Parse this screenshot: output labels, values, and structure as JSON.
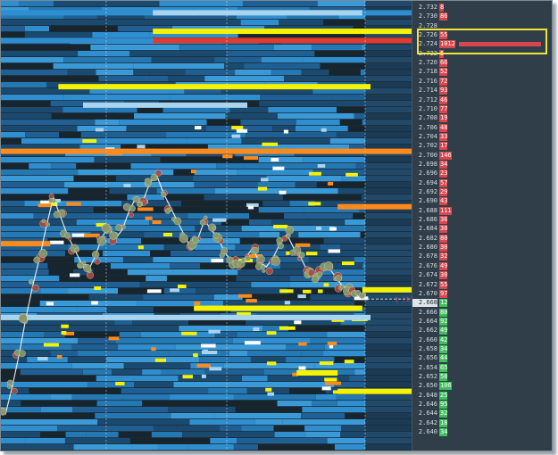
{
  "colors": {
    "background": "#1e2a33",
    "ladder_background": "#2f3e49",
    "ask_volume": "#d9464c",
    "bid_volume": "#3fbf59",
    "liquidity_low": "#1f5f93",
    "liquidity_mid": "#2e8ed0",
    "liquidity_light": "#a9d4ef",
    "liquidity_high": "#f7f200",
    "liquidity_very_high": "#ff8a1c",
    "liquidity_max": "#e43a2c",
    "trade_bubble": "#b04a3c",
    "highlight_box": "#f0e33a",
    "current_price_marker": "#d9464c"
  },
  "current_price_marker": "1 (1)",
  "ladder": {
    "current_price": "2.668",
    "rows": [
      {
        "price": "2.732",
        "volume": "8",
        "side": "ask",
        "bar": 0
      },
      {
        "price": "2.730",
        "volume": "86",
        "side": "ask",
        "bar": 0
      },
      {
        "price": "2.728",
        "volume": "",
        "side": "ask",
        "bar": 0
      },
      {
        "price": "2.726",
        "volume": "55",
        "side": "ask",
        "bar": 0
      },
      {
        "price": "2.724",
        "volume": "1012",
        "side": "ask",
        "bar": 1012
      },
      {
        "price": "2.722",
        "volume": "5",
        "side": "ask",
        "bar": 0
      },
      {
        "price": "2.720",
        "volume": "66",
        "side": "ask",
        "bar": 0
      },
      {
        "price": "2.718",
        "volume": "52",
        "side": "ask",
        "bar": 0
      },
      {
        "price": "2.716",
        "volume": "72",
        "side": "ask",
        "bar": 0
      },
      {
        "price": "2.714",
        "volume": "93",
        "side": "ask",
        "bar": 0
      },
      {
        "price": "2.712",
        "volume": "46",
        "side": "ask",
        "bar": 0
      },
      {
        "price": "2.710",
        "volume": "77",
        "side": "ask",
        "bar": 0
      },
      {
        "price": "2.708",
        "volume": "19",
        "side": "ask",
        "bar": 0
      },
      {
        "price": "2.706",
        "volume": "48",
        "side": "ask",
        "bar": 0
      },
      {
        "price": "2.704",
        "volume": "33",
        "side": "ask",
        "bar": 0
      },
      {
        "price": "2.702",
        "volume": "17",
        "side": "ask",
        "bar": 0
      },
      {
        "price": "2.700",
        "volume": "146",
        "side": "ask",
        "bar": 0
      },
      {
        "price": "2.698",
        "volume": "34",
        "side": "ask",
        "bar": 0
      },
      {
        "price": "2.696",
        "volume": "23",
        "side": "ask",
        "bar": 0
      },
      {
        "price": "2.694",
        "volume": "57",
        "side": "ask",
        "bar": 0
      },
      {
        "price": "2.692",
        "volume": "29",
        "side": "ask",
        "bar": 0
      },
      {
        "price": "2.690",
        "volume": "43",
        "side": "ask",
        "bar": 0
      },
      {
        "price": "2.688",
        "volume": "111",
        "side": "ask",
        "bar": 0
      },
      {
        "price": "2.686",
        "volume": "36",
        "side": "ask",
        "bar": 0
      },
      {
        "price": "2.684",
        "volume": "30",
        "side": "ask",
        "bar": 0
      },
      {
        "price": "2.682",
        "volume": "80",
        "side": "ask",
        "bar": 0
      },
      {
        "price": "2.680",
        "volume": "30",
        "side": "ask",
        "bar": 0
      },
      {
        "price": "2.678",
        "volume": "32",
        "side": "ask",
        "bar": 0
      },
      {
        "price": "2.676",
        "volume": "49",
        "side": "ask",
        "bar": 0
      },
      {
        "price": "2.674",
        "volume": "30",
        "side": "ask",
        "bar": 0
      },
      {
        "price": "2.672",
        "volume": "55",
        "side": "ask",
        "bar": 0
      },
      {
        "price": "2.670",
        "volume": "97",
        "side": "ask",
        "bar": 0
      },
      {
        "price": "2.668",
        "volume": "12",
        "side": "bid",
        "bar": 0
      },
      {
        "price": "2.666",
        "volume": "80",
        "side": "bid",
        "bar": 0
      },
      {
        "price": "2.664",
        "volume": "92",
        "side": "bid",
        "bar": 0
      },
      {
        "price": "2.662",
        "volume": "49",
        "side": "bid",
        "bar": 0
      },
      {
        "price": "2.660",
        "volume": "42",
        "side": "bid",
        "bar": 0
      },
      {
        "price": "2.658",
        "volume": "34",
        "side": "bid",
        "bar": 0
      },
      {
        "price": "2.656",
        "volume": "44",
        "side": "bid",
        "bar": 0
      },
      {
        "price": "2.654",
        "volume": "65",
        "side": "bid",
        "bar": 0
      },
      {
        "price": "2.652",
        "volume": "58",
        "side": "bid",
        "bar": 0
      },
      {
        "price": "2.650",
        "volume": "106",
        "side": "bid",
        "bar": 0
      },
      {
        "price": "2.648",
        "volume": "25",
        "side": "bid",
        "bar": 0
      },
      {
        "price": "2.646",
        "volume": "95",
        "side": "bid",
        "bar": 0
      },
      {
        "price": "2.644",
        "volume": "32",
        "side": "bid",
        "bar": 0
      },
      {
        "price": "2.642",
        "volume": "18",
        "side": "bid",
        "bar": 0
      },
      {
        "price": "2.640",
        "volume": "34",
        "side": "bid",
        "bar": 0
      }
    ]
  },
  "chart_data": {
    "type": "heatmap",
    "title": "",
    "xlabel": "",
    "ylabel": "",
    "y_axis": {
      "min": 2.64,
      "max": 2.732,
      "tick_step": 0.002
    },
    "price_path": [
      2.643,
      2.649,
      2.656,
      2.664,
      2.671,
      2.677,
      2.684,
      2.69,
      2.686,
      2.682,
      2.679,
      2.676,
      2.674,
      2.677,
      2.681,
      2.684,
      2.681,
      2.683,
      2.687,
      2.69,
      2.689,
      2.693,
      2.695,
      2.691,
      2.688,
      2.685,
      2.682,
      2.679,
      2.681,
      2.685,
      2.683,
      2.681,
      2.678,
      2.676,
      2.675,
      2.677,
      2.679,
      2.676,
      2.675,
      2.677,
      2.68,
      2.682,
      2.679,
      2.677,
      2.674,
      2.673,
      2.674,
      2.675,
      2.673,
      2.671,
      2.67,
      2.669,
      2.668
    ],
    "heat_bands": [
      {
        "price": 2.73,
        "start": 0.0,
        "end": 1.0,
        "level": "mid"
      },
      {
        "price": 2.73,
        "start": 0.37,
        "end": 0.88,
        "level": "light"
      },
      {
        "price": 2.726,
        "start": 0.37,
        "end": 1.0,
        "level": "high"
      },
      {
        "price": 2.724,
        "start": 0.37,
        "end": 1.0,
        "level": "max"
      },
      {
        "price": 2.724,
        "start": 0.0,
        "end": 0.37,
        "level": "mid"
      },
      {
        "price": 2.714,
        "start": 0.14,
        "end": 0.9,
        "level": "high"
      },
      {
        "price": 2.71,
        "start": 0.2,
        "end": 0.6,
        "level": "light"
      },
      {
        "price": 2.7,
        "start": 0.0,
        "end": 1.0,
        "level": "very_high"
      },
      {
        "price": 2.688,
        "start": 0.82,
        "end": 1.0,
        "level": "very_high"
      },
      {
        "price": 2.68,
        "start": 0.0,
        "end": 0.12,
        "level": "very_high"
      },
      {
        "price": 2.67,
        "start": 0.88,
        "end": 1.0,
        "level": "high"
      },
      {
        "price": 2.666,
        "start": 0.47,
        "end": 0.88,
        "level": "high"
      },
      {
        "price": 2.664,
        "start": 0.0,
        "end": 0.9,
        "level": "light"
      },
      {
        "price": 2.652,
        "start": 0.72,
        "end": 0.82,
        "level": "high"
      },
      {
        "price": 2.648,
        "start": 0.82,
        "end": 1.0,
        "level": "high"
      }
    ]
  }
}
